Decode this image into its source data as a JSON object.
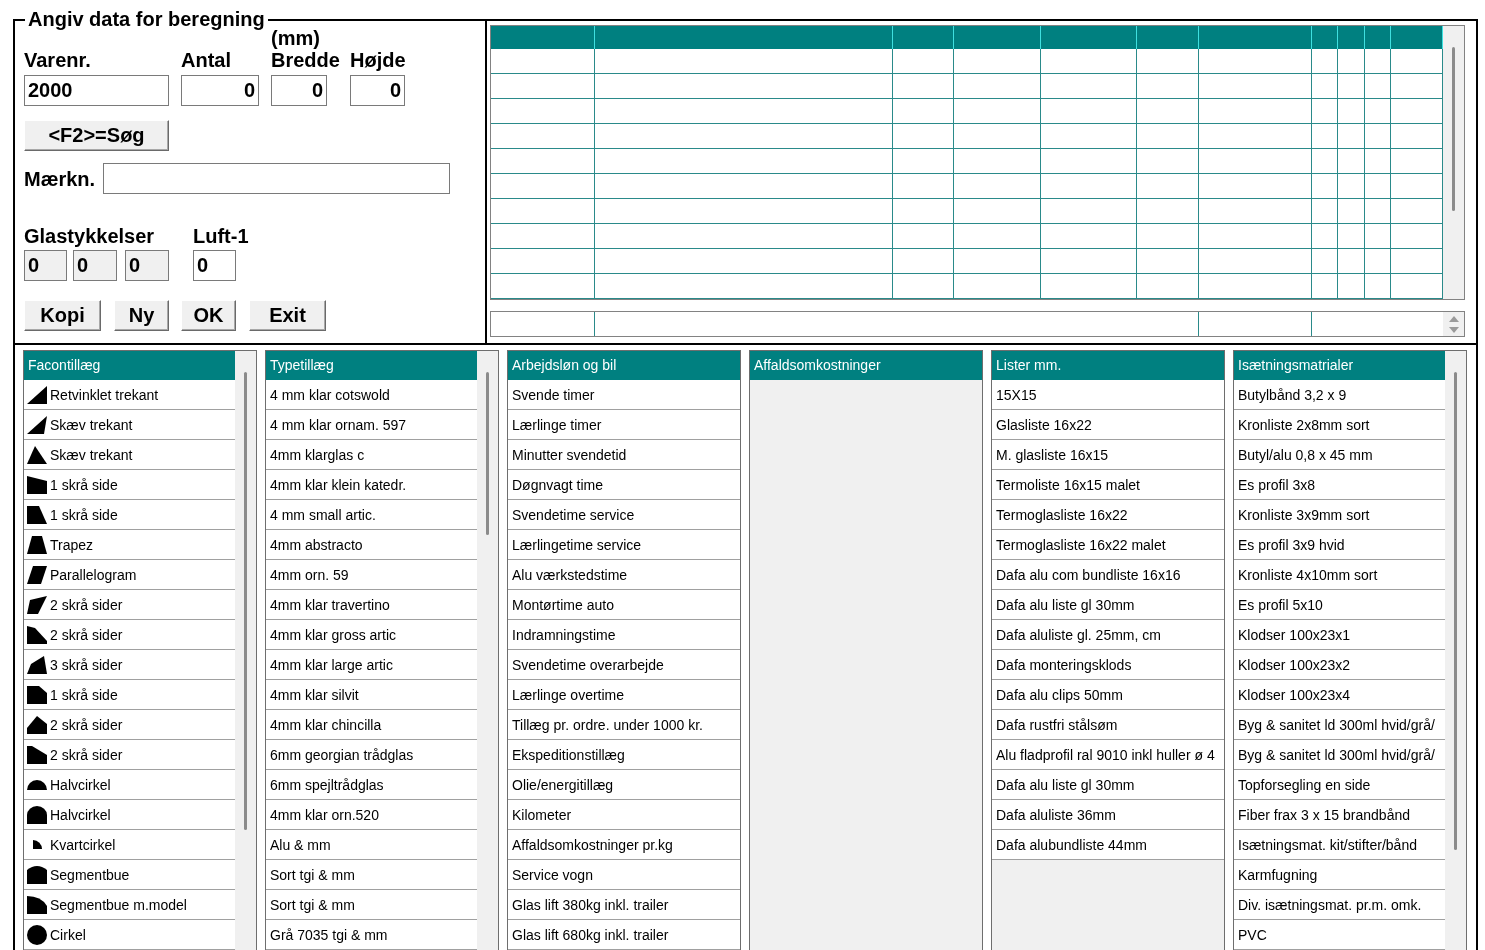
{
  "form": {
    "legend": "Angiv data for beregning",
    "item_fields": [
      {
        "label": "Varenr.",
        "value": "2000",
        "kind": "text"
      },
      {
        "label": "Antal",
        "value": "0",
        "kind": "number"
      },
      {
        "label": "Bredde",
        "unit": "(mm)",
        "value": "0",
        "kind": "number"
      },
      {
        "label": "Højde",
        "value": "0",
        "kind": "number"
      }
    ],
    "search_button": "<F2>=Søg",
    "note_field": {
      "label": "Mærkn."
    },
    "thickness_label": "Glastykkelser",
    "thickness_fields": [
      {
        "value": "0",
        "disabled": true
      },
      {
        "value": "0",
        "disabled": true
      },
      {
        "value": "0",
        "disabled": true
      }
    ],
    "air_label": "Luft-1",
    "air_field": {
      "value": "0",
      "disabled": false
    },
    "buttons": [
      "Kopi",
      "Ny",
      "OK",
      "Exit"
    ]
  },
  "lists": [
    {
      "title": "Facontillæg",
      "scrollbar": true,
      "items": [
        {
          "label": "Retvinklet trekant",
          "kind": "wedge"
        },
        {
          "label": "Skæv trekant",
          "kind": "skew"
        },
        {
          "label": "Skæv trekant",
          "kind": "peak"
        },
        {
          "label": "1 skrå side",
          "kind": "slope"
        },
        {
          "label": "1 skrå side",
          "kind": "lean"
        },
        {
          "label": "Trapez",
          "kind": "trapezoid"
        },
        {
          "label": "Parallelogram",
          "kind": "parallelogram"
        },
        {
          "label": "2 skrå sider",
          "kind": "rhomboid"
        },
        {
          "label": "2 skrå sider",
          "kind": "chamfer"
        },
        {
          "label": "3 skrå sider",
          "kind": "tilt"
        },
        {
          "label": "1 skrå side",
          "kind": "corner"
        },
        {
          "label": "2 skrå sider",
          "kind": "gable"
        },
        {
          "label": "2 skrå sider",
          "kind": "bevel"
        },
        {
          "label": "Halvcirkel",
          "kind": "semicircle"
        },
        {
          "label": "Halvcirkel",
          "kind": "arch"
        },
        {
          "label": "Kvartcirkel",
          "kind": "quarter"
        },
        {
          "label": "Segmentbue",
          "kind": "segment"
        },
        {
          "label": "Segmentbue m.model",
          "kind": "curve"
        },
        {
          "label": "Cirkel",
          "kind": "circle"
        }
      ]
    },
    {
      "title": "Typetillæg",
      "scrollbar": true,
      "items": [
        {
          "label": "4 mm klar cotswold"
        },
        {
          "label": "4 mm klar ornam. 597"
        },
        {
          "label": "4mm klarglas c"
        },
        {
          "label": "4mm klar klein katedr."
        },
        {
          "label": "4 mm small artic."
        },
        {
          "label": "4mm abstracto"
        },
        {
          "label": "4mm orn. 59"
        },
        {
          "label": "4mm klar travertino"
        },
        {
          "label": "4mm klar gross artic"
        },
        {
          "label": "4mm klar large artic"
        },
        {
          "label": "4mm klar silvit"
        },
        {
          "label": "4mm klar chincilla"
        },
        {
          "label": "6mm georgian trådglas"
        },
        {
          "label": "6mm spejltrådglas"
        },
        {
          "label": "4mm klar orn.520"
        },
        {
          "label": "Alu & mm"
        },
        {
          "label": "Sort tgi & mm"
        },
        {
          "label": "Sort tgi & mm"
        },
        {
          "label": "Grå 7035 tgi & mm"
        }
      ]
    },
    {
      "title": "Arbejdsløn og bil",
      "scrollbar": false,
      "items": [
        {
          "label": "Svende timer"
        },
        {
          "label": "Lærlinge timer"
        },
        {
          "label": "Minutter svendetid"
        },
        {
          "label": "Døgnvagt time"
        },
        {
          "label": "Svendetime service"
        },
        {
          "label": "Lærlingetime service"
        },
        {
          "label": "Alu værkstedstime"
        },
        {
          "label": "Montørtime auto"
        },
        {
          "label": "Indramningstime"
        },
        {
          "label": "Svendetime overarbejde"
        },
        {
          "label": "Lærlinge overtime"
        },
        {
          "label": "Tillæg pr. ordre. under 1000 kr."
        },
        {
          "label": "Ekspeditionstillæg"
        },
        {
          "label": "Olie/energitillæg"
        },
        {
          "label": "Kilometer"
        },
        {
          "label": "Affaldsomkostninger pr.kg"
        },
        {
          "label": "Service vogn"
        },
        {
          "label": "Glas lift 380kg inkl. trailer"
        },
        {
          "label": "Glas lift 680kg inkl. trailer"
        }
      ]
    },
    {
      "title": "Affaldsomkostninger",
      "scrollbar": false
    },
    {
      "title": "Lister mm.",
      "scrollbar": false,
      "items": [
        {
          "label": "15X15"
        },
        {
          "label": "Glasliste 16x22"
        },
        {
          "label": "M. glasliste 16x15"
        },
        {
          "label": "Termoliste 16x15 malet"
        },
        {
          "label": "Termoglasliste 16x22"
        },
        {
          "label": "Termoglasliste 16x22 malet"
        },
        {
          "label": "Dafa alu com bundliste 16x16"
        },
        {
          "label": "Dafa alu liste gl 30mm"
        },
        {
          "label": "Dafa aluliste gl. 25mm, cm"
        },
        {
          "label": "Dafa monteringsklods"
        },
        {
          "label": "Dafa alu clips 50mm"
        },
        {
          "label": "Dafa rustfri stålsøm"
        },
        {
          "label": "Alu fladprofil ral 9010 inkl huller ø 4"
        },
        {
          "label": "Dafa alu liste gl 30mm"
        },
        {
          "label": "Dafa aluliste 36mm"
        },
        {
          "label": "Dafa alubundliste 44mm"
        }
      ]
    },
    {
      "title": "Isætningsmatrialer",
      "scrollbar": true,
      "items": [
        {
          "label": "Butylbånd 3,2 x 9"
        },
        {
          "label": "Kronliste 2x8mm sort"
        },
        {
          "label": "Butyl/alu 0,8 x 45 mm"
        },
        {
          "label": "Es profil 3x8"
        },
        {
          "label": "Kronliste 3x9mm sort"
        },
        {
          "label": "Es profil 3x9 hvid"
        },
        {
          "label": "Kronliste 4x10mm sort"
        },
        {
          "label": "Es profil 5x10"
        },
        {
          "label": "Klodser 100x23x1"
        },
        {
          "label": "Klodser 100x23x2"
        },
        {
          "label": "Klodser 100x23x4"
        },
        {
          "label": "Byg & sanitet ld 300ml hvid/grå/"
        },
        {
          "label": "Byg & sanitet ld 300ml hvid/grå/"
        },
        {
          "label": "Topforsegling en side"
        },
        {
          "label": "Fiber frax 3 x 15 brandbånd"
        },
        {
          "label": "Isætningsmat. kit/stifter/bånd"
        },
        {
          "label": "Karmfugning"
        },
        {
          "label": "Div. isætningsmat. pr.m. omk."
        },
        {
          "label": "PVC"
        }
      ]
    }
  ]
}
